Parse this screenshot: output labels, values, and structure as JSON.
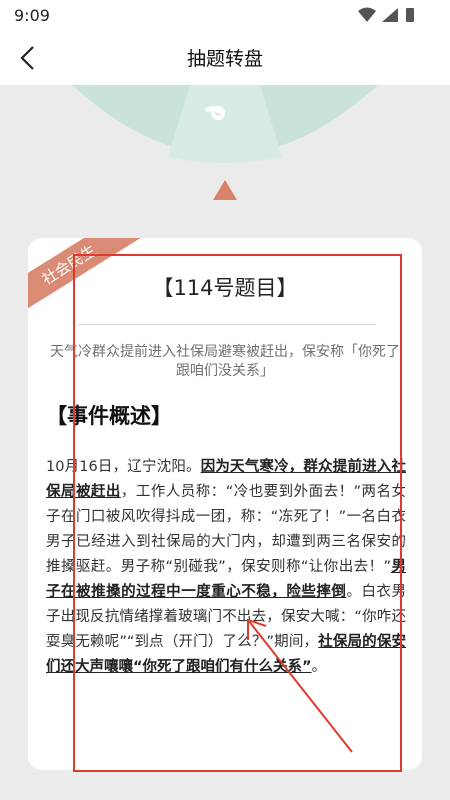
{
  "status_bar": {
    "time": "9:09"
  },
  "header": {
    "title": "抽题转盘"
  },
  "card": {
    "category": "社会民生",
    "question_title": "【114号题目】",
    "subtitle": "天气冷群众提前进入社保局避寒被赶出，保安称「你死了跟咱们没关系」",
    "section_heading": "【事件概述】",
    "paragraph": {
      "p1": "10月16日，辽宁沈阳。",
      "e1": "因为天气寒冷，群众提前进入社保局被赶出",
      "p2": "，工作人员称：“冷也要到外面去！”两名女子在门口被风吹得抖成一团，称：“冻死了！”一名白衣男子已经进入到社保局的大门内，却遭到两三名保安的推搡驱赶。男子称“别碰我”，保安则称“让你出去！”",
      "e2": "男子在被推搡的过程中一度重心不稳，险些摔倒",
      "p3": "。白衣男子出现反抗情绪撑着玻璃门不出去，保安大喊：“你咋还耍臭无赖呢”“到点（开门）了么？”期间，",
      "e3": "社保局的保安们还大声嚷嚷“你死了跟咱们有什么关系”",
      "p4": "。"
    }
  },
  "colors": {
    "wheel": "#c9e3d8",
    "accent": "#d9826a",
    "highlight": "#e03a2f"
  }
}
